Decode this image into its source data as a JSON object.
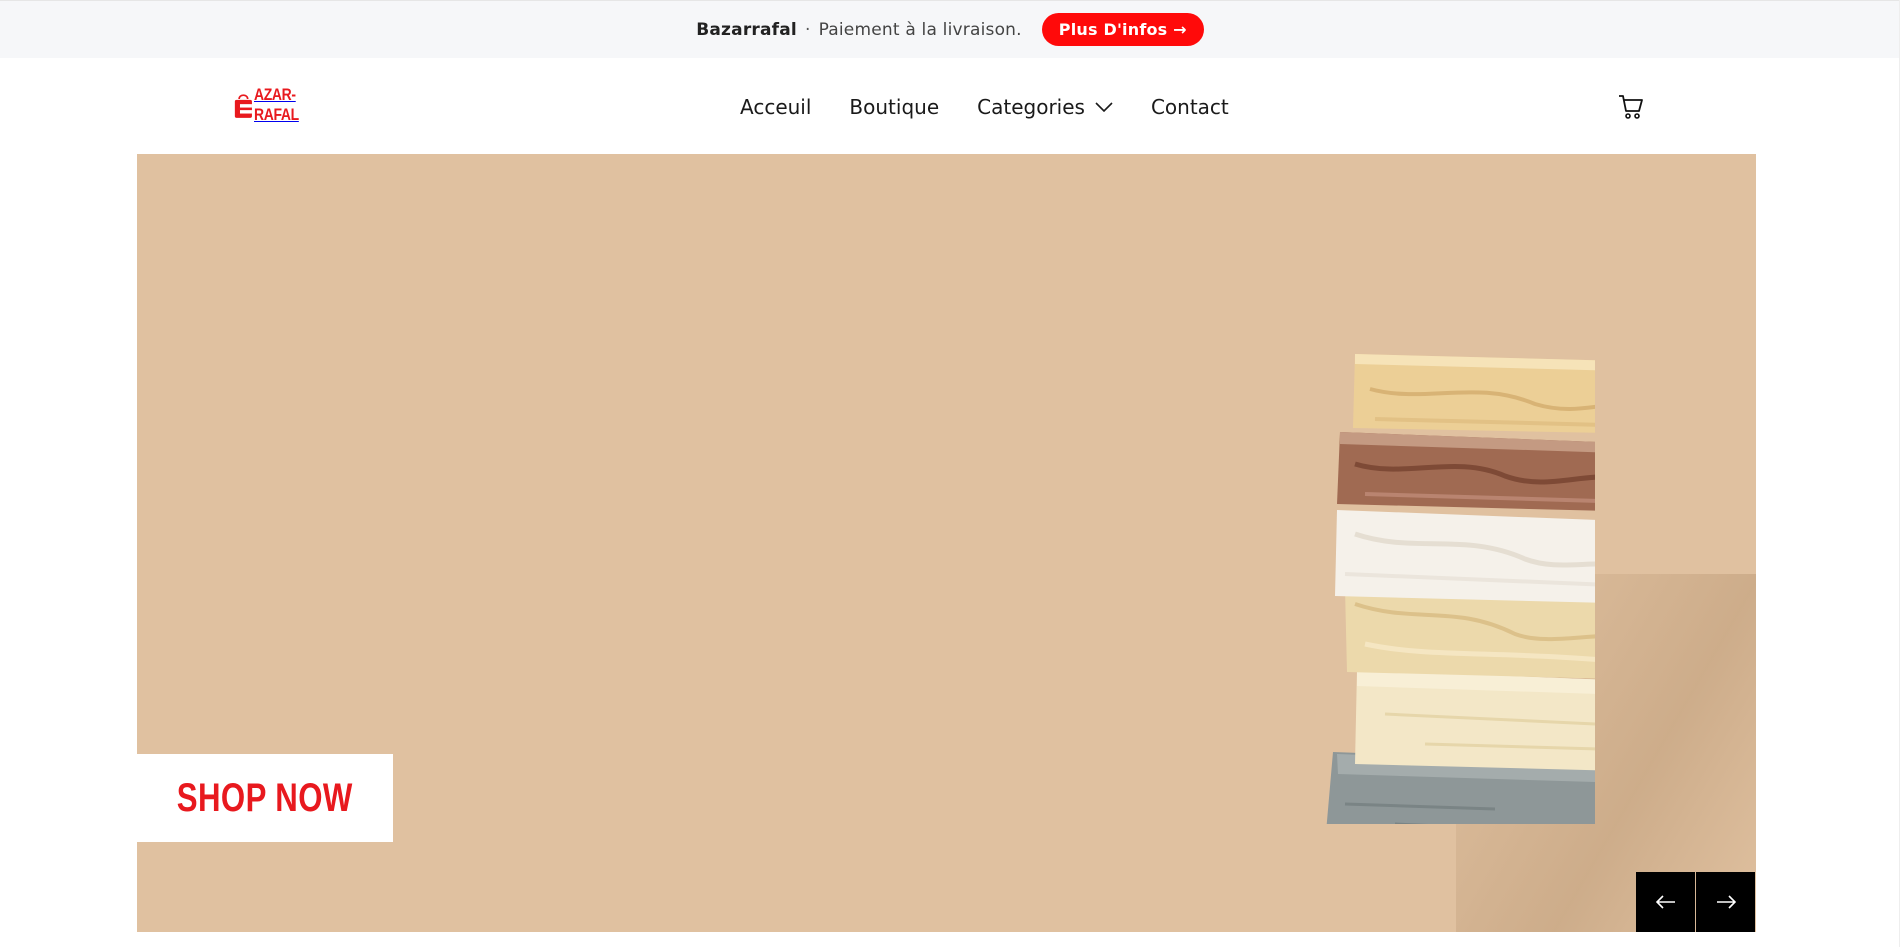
{
  "announcement": {
    "brand": "Bazarrafal",
    "separator": "·",
    "message": "Paiement à la livraison.",
    "cta_label": "Plus D'infos →"
  },
  "header": {
    "logo_text": "AZAR-RAFAL",
    "nav": [
      {
        "label": "Acceuil"
      },
      {
        "label": "Boutique"
      },
      {
        "label": "Categories"
      },
      {
        "label": "Contact"
      }
    ],
    "cart_icon": "cart-icon"
  },
  "hero": {
    "shop_now_label": "SHOP NOW",
    "prev_icon": "arrow-left-icon",
    "next_icon": "arrow-right-icon",
    "background_color": "#e0c1a0"
  },
  "colors": {
    "accent": "#ff0a0a",
    "logo": "#e8191e",
    "announcement_bg": "#f6f7f9"
  }
}
